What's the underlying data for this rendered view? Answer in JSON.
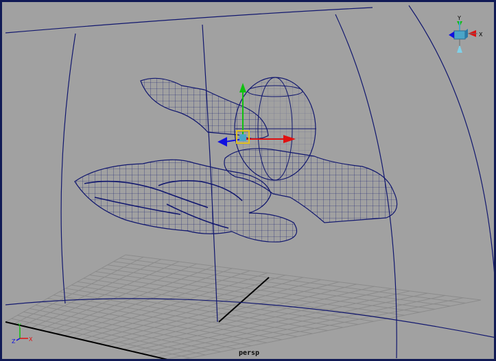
{
  "viewport": {
    "camera_label": "persp",
    "view_cube": {
      "y": "Y",
      "x": "X"
    },
    "axis_triad": {
      "y": "Y",
      "z": "Z",
      "x": "X"
    }
  },
  "colors": {
    "background": "#a1a1a1",
    "wireframe": "#10166e",
    "grid": "#8b8b8b",
    "manip_x": "#e01010",
    "manip_y": "#10c010",
    "manip_z": "#1010e0",
    "manip_center": "#e0c020"
  }
}
